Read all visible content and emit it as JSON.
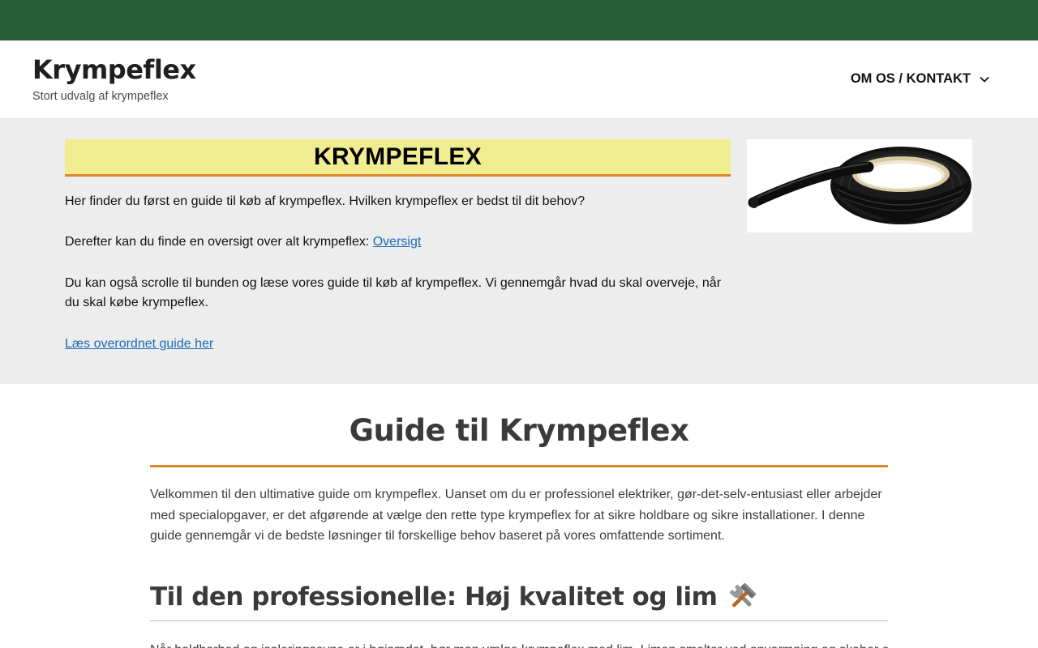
{
  "header": {
    "site_title": "Krympeflex",
    "tagline": "Stort udvalg af krympeflex",
    "nav_item": "OM OS / KONTAKT",
    "colors": {
      "top_bar": "#255e34",
      "accent": "#e0852a",
      "heading_bg": "#f0ed91",
      "link": "#1a6ab8"
    }
  },
  "intro": {
    "heading": "KRYMPEFLEX",
    "p1": "Her finder du først en guide til køb af krympeflex. Hvilken krympeflex er bedst til dit behov?",
    "p2_text": "Derefter kan du finde en oversigt over alt krympeflex: ",
    "p2_link": "Oversigt",
    "p3": "Du kan også scrolle til bunden og læse vores guide til køb af krympeflex. Vi gennemgår hvad du skal overveje, når du skal købe krympeflex.",
    "p4_link": "Læs overordnet guide her"
  },
  "guide": {
    "title": "Guide til Krympeflex",
    "intro": "Velkommen til den ultimative guide om krympeflex. Uanset om du er professionel elektriker, gør-det-selv-entusiast eller arbejder med specialopgaver, er det afgørende at vælge den rette type krympeflex for at sikre holdbare og sikre installationer. I denne guide gennemgår vi de bedste løsninger til forskellige behov baseret på vores omfattende sortiment.",
    "section1_heading": "Til den professionelle: Høj kvalitet og lim",
    "section1_text": "Når holdbarhed og isoleringsevne er i højsædet, bør man vælge krympeflex med lim. Limen smelter ved opvarmning og skaber en"
  }
}
